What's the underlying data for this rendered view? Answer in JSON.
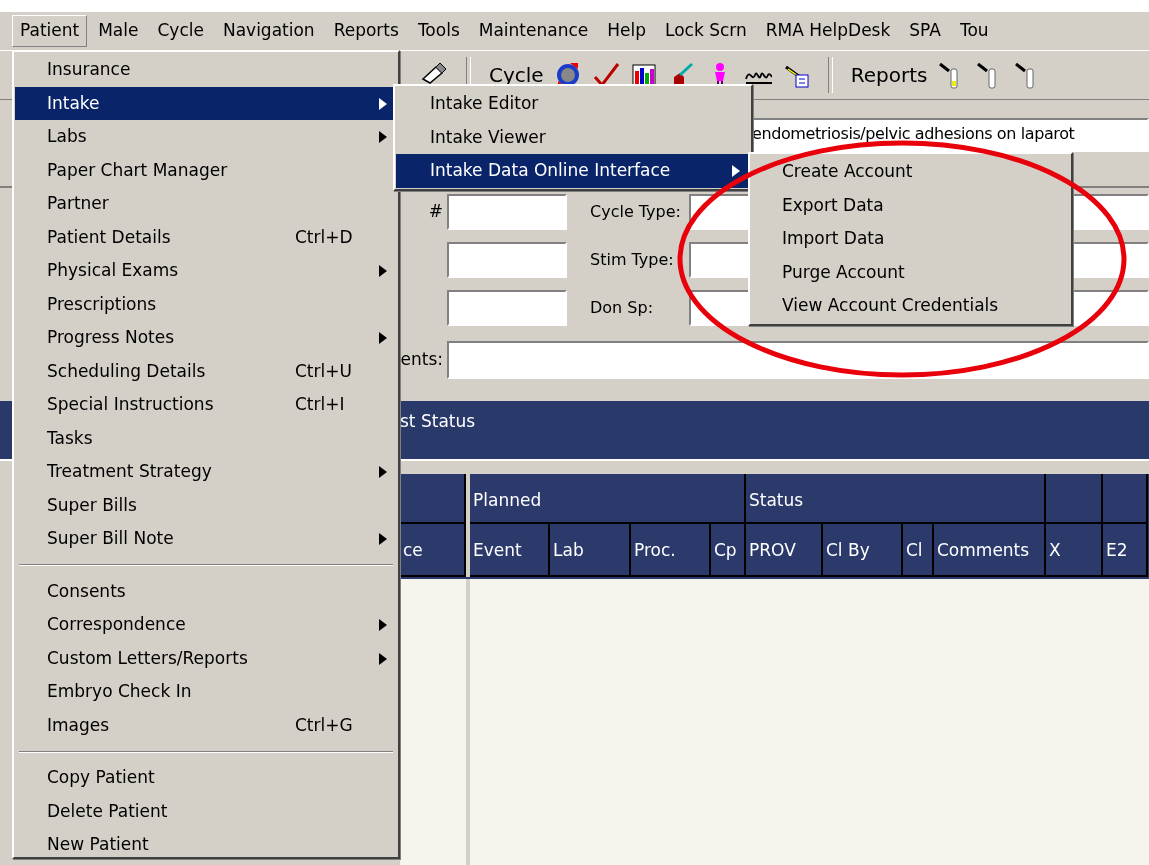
{
  "menu_bar": [
    {
      "label": "Patient",
      "selected": true
    },
    {
      "label": "Male",
      "selected": false
    },
    {
      "label": "Cycle",
      "selected": false
    },
    {
      "label": "Navigation",
      "selected": false
    },
    {
      "label": "Reports",
      "selected": false
    },
    {
      "label": "Tools",
      "selected": false
    },
    {
      "label": "Maintenance",
      "selected": false
    },
    {
      "label": "Help",
      "selected": false
    },
    {
      "label": "Lock Scrn",
      "selected": false
    },
    {
      "label": "RMA HelpDesk",
      "selected": false
    },
    {
      "label": "SPA",
      "selected": false
    },
    {
      "label": "Tou",
      "selected": false
    }
  ],
  "toolbar": {
    "cycle_label": "Cycle",
    "reports_label": "Reports"
  },
  "form": {
    "diagnosis": "endometriosis/pelvic adhesions on laparot",
    "rows": [
      {
        "label": "#",
        "label_2": "Cycle Type:"
      },
      {
        "label_2": "Stim Type:"
      },
      {
        "label_2": "Don Sp:"
      }
    ],
    "comments_label": "ents:"
  },
  "status_band": "st Status",
  "grid": {
    "groups": [
      {
        "label": "Planned"
      },
      {
        "label": "Status"
      }
    ],
    "columns": [
      "ce",
      "Event",
      "Lab",
      "Proc.",
      "Cp",
      "PROV",
      "Cl By",
      "Cl",
      "Comments",
      "X",
      "E2"
    ]
  },
  "patient_menu": [
    {
      "kind": "item",
      "label": "Insurance",
      "submenu": false,
      "selected": false
    },
    {
      "kind": "item",
      "label": "Intake",
      "submenu": true,
      "selected": true
    },
    {
      "kind": "item",
      "label": "Labs",
      "submenu": true,
      "selected": false
    },
    {
      "kind": "item",
      "label": "Paper Chart Manager",
      "submenu": false,
      "selected": false
    },
    {
      "kind": "item",
      "label": "Partner",
      "submenu": false,
      "selected": false
    },
    {
      "kind": "item",
      "label": "Patient Details",
      "shortcut": "Ctrl+D",
      "submenu": false,
      "selected": false
    },
    {
      "kind": "item",
      "label": "Physical Exams",
      "submenu": true,
      "selected": false
    },
    {
      "kind": "item",
      "label": "Prescriptions",
      "submenu": false,
      "selected": false
    },
    {
      "kind": "item",
      "label": "Progress Notes",
      "submenu": true,
      "selected": false
    },
    {
      "kind": "item",
      "label": "Scheduling Details",
      "shortcut": "Ctrl+U",
      "submenu": false,
      "selected": false
    },
    {
      "kind": "item",
      "label": "Special Instructions",
      "shortcut": "Ctrl+I",
      "submenu": false,
      "selected": false
    },
    {
      "kind": "item",
      "label": "Tasks",
      "submenu": false,
      "selected": false
    },
    {
      "kind": "item",
      "label": "Treatment Strategy",
      "submenu": true,
      "selected": false
    },
    {
      "kind": "item",
      "label": "Super Bills",
      "submenu": false,
      "selected": false
    },
    {
      "kind": "item",
      "label": "Super Bill Note",
      "submenu": true,
      "selected": false
    },
    {
      "kind": "separator"
    },
    {
      "kind": "item",
      "label": "Consents",
      "submenu": false,
      "selected": false
    },
    {
      "kind": "item",
      "label": "Correspondence",
      "submenu": true,
      "selected": false
    },
    {
      "kind": "item",
      "label": "Custom Letters/Reports",
      "submenu": true,
      "selected": false
    },
    {
      "kind": "item",
      "label": "Embryo Check In",
      "submenu": false,
      "selected": false
    },
    {
      "kind": "item",
      "label": "Images",
      "shortcut": "Ctrl+G",
      "submenu": false,
      "selected": false
    },
    {
      "kind": "separator"
    },
    {
      "kind": "item",
      "label": "Copy Patient",
      "submenu": false,
      "selected": false
    },
    {
      "kind": "item",
      "label": "Delete Patient",
      "submenu": false,
      "selected": false
    },
    {
      "kind": "item",
      "label": "New Patient",
      "submenu": false,
      "selected": false
    }
  ],
  "intake_submenu": [
    {
      "kind": "item",
      "label": "Intake Editor",
      "submenu": false,
      "selected": false
    },
    {
      "kind": "item",
      "label": "Intake Viewer",
      "submenu": false,
      "selected": false
    },
    {
      "kind": "item",
      "label": "Intake Data Online Interface",
      "submenu": true,
      "selected": true
    }
  ],
  "online_interface_submenu": [
    {
      "kind": "item",
      "label": "Create Account",
      "submenu": false,
      "selected": false
    },
    {
      "kind": "item",
      "label": "Export Data",
      "submenu": false,
      "selected": false
    },
    {
      "kind": "item",
      "label": "Import Data",
      "submenu": false,
      "selected": false
    },
    {
      "kind": "item",
      "label": "Purge Account",
      "submenu": false,
      "selected": false
    },
    {
      "kind": "item",
      "label": "View Account Credentials",
      "submenu": false,
      "selected": false
    }
  ]
}
